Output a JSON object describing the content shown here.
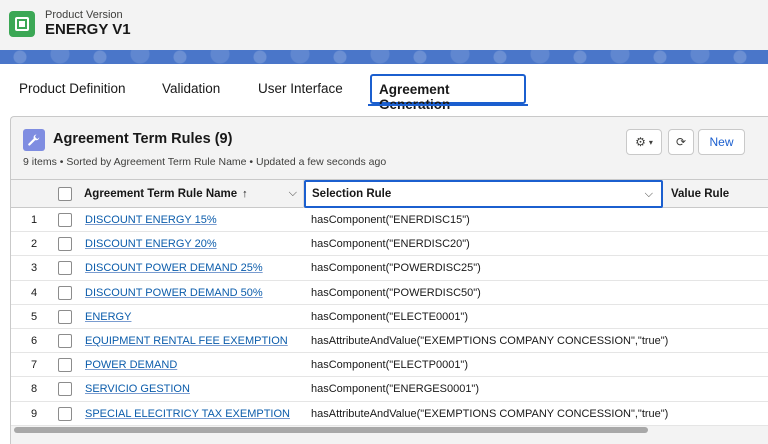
{
  "header": {
    "object_label": "Product Version",
    "record_title": "ENERGY V1"
  },
  "tabs": [
    {
      "label": "Product Definition"
    },
    {
      "label": "Validation"
    },
    {
      "label": "User Interface"
    },
    {
      "label": "Agreement Generation",
      "active": true
    }
  ],
  "card": {
    "title": "Agreement Term Rules (9)",
    "subtitle": "9 items • Sorted by Agreement Term Rule Name • Updated a few seconds ago",
    "new_label": "New"
  },
  "table": {
    "columns": {
      "name": "Agreement Term Rule Name",
      "sort_arrow": "↑",
      "selection": "Selection Rule",
      "value": "Value Rule"
    },
    "rows": [
      {
        "n": "1",
        "name": "DISCOUNT ENERGY 15%",
        "rule": "hasComponent(\"ENERDISC15\")"
      },
      {
        "n": "2",
        "name": "DISCOUNT ENERGY 20%",
        "rule": "hasComponent(\"ENERDISC20\")"
      },
      {
        "n": "3",
        "name": "DISCOUNT POWER DEMAND 25%",
        "rule": "hasComponent(\"POWERDISC25\")"
      },
      {
        "n": "4",
        "name": "DISCOUNT POWER DEMAND 50%",
        "rule": "hasComponent(\"POWERDISC50\")"
      },
      {
        "n": "5",
        "name": "ENERGY",
        "rule": "hasComponent(\"ELECTE0001\")"
      },
      {
        "n": "6",
        "name": "EQUIPMENT RENTAL FEE EXEMPTION",
        "rule": "hasAttributeAndValue(\"EXEMPTIONS COMPANY CONCESSION\",\"true\")"
      },
      {
        "n": "7",
        "name": "POWER DEMAND",
        "rule": "hasComponent(\"ELECTP0001\")"
      },
      {
        "n": "8",
        "name": "SERVICIO GESTION",
        "rule": "hasComponent(\"ENERGES0001\")"
      },
      {
        "n": "9",
        "name": "SPECIAL ELECITRICY TAX EXEMPTION",
        "rule": "hasAttributeAndValue(\"EXEMPTIONS COMPANY CONCESSION\",\"true\")"
      }
    ]
  },
  "icons": {
    "app": "chip-icon",
    "card": "wrench-icon",
    "settings": "gear-icon",
    "refresh": "refresh-icon"
  },
  "colors": {
    "accent": "#1b5fcf",
    "app_icon": "#3ba755",
    "card_icon": "#7f8de1",
    "link": "#0b5cab"
  }
}
